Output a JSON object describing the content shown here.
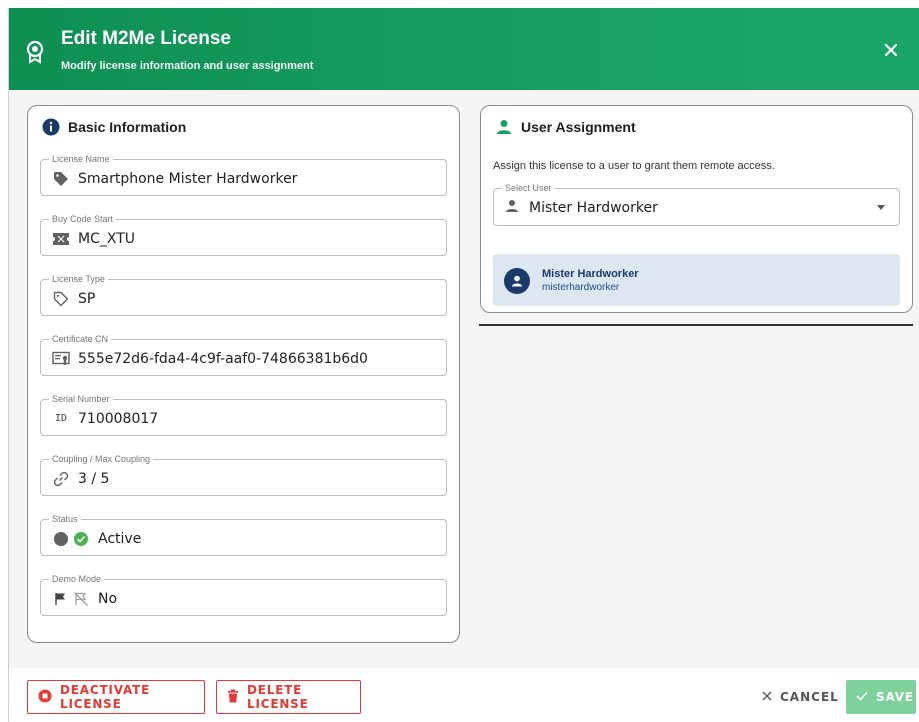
{
  "dialog": {
    "title": "Edit M2Me License",
    "subtitle": "Modify license information and user assignment",
    "close_icon": "close-icon",
    "brand_color": "#17a062"
  },
  "basic": {
    "title": "Basic Information",
    "fields": {
      "license_name": {
        "label": "License Name",
        "value": "Smartphone Mister Hardworker",
        "icon": "tag-icon"
      },
      "buy_code_start": {
        "label": "Buy Code Start",
        "value": "MC_XTU",
        "icon": "ticket-icon"
      },
      "license_type": {
        "label": "License Type",
        "value": "SP",
        "icon": "label-outline-icon"
      },
      "certificate_cn": {
        "label": "Certificate CN",
        "value": "555e72d6-fda4-4c9f-aaf0-74866381b6d0",
        "icon": "certificate-icon"
      },
      "serial_number": {
        "label": "Serial Number",
        "value": "710008017",
        "icon_text": "ID"
      },
      "coupling": {
        "label": "Coupling / Max Coupling",
        "value": "3 / 5",
        "icon": "link-icon"
      },
      "status": {
        "label": "Status",
        "value": "Active",
        "icon": "check-circle-icon",
        "status_color": "#4caf50"
      },
      "demo_mode": {
        "label": "Demo Mode",
        "value": "No",
        "icon": "flag-off-icon"
      }
    }
  },
  "user_assignment": {
    "title": "User Assignment",
    "description": "Assign this license to a user to grant them remote access.",
    "select": {
      "label": "Select User",
      "value": "Mister Hardworker"
    },
    "selected_user": {
      "name": "Mister Hardworker",
      "login": "misterhardworker"
    }
  },
  "footer": {
    "deactivate_label": "DEACTIVATE LICENSE",
    "delete_label": "DELETE LICENSE",
    "cancel_label": "CANCEL",
    "save_label": "SAVE",
    "danger_color": "#e53935",
    "save_color": "#7fd19b"
  }
}
